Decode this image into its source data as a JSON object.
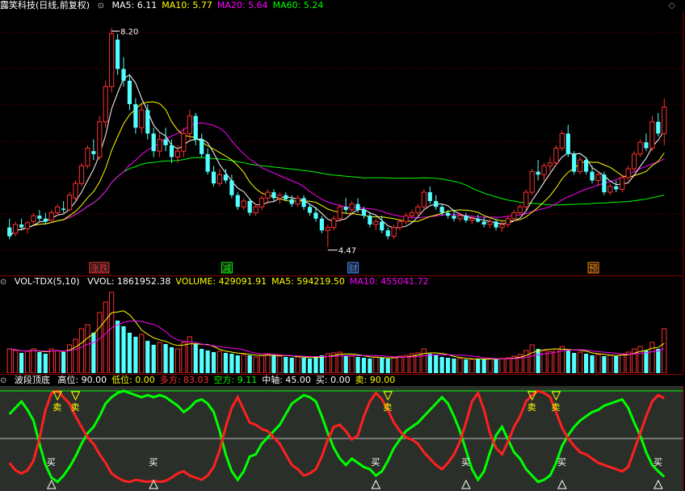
{
  "main": {
    "title": "露笑科技(日线,前复权)",
    "ma": [
      {
        "label": "MA5:",
        "value": "6.11",
        "color": "#ffffff"
      },
      {
        "label": "MA10:",
        "value": "5.77",
        "color": "#ffff00"
      },
      {
        "label": "MA20:",
        "value": "5.64",
        "color": "#ff00ff"
      },
      {
        "label": "MA60:",
        "value": "5.24",
        "color": "#00ff00"
      }
    ],
    "high_label": "8.20",
    "low_label": "4.47",
    "events": [
      {
        "text": "涨跌",
        "color": "#ff3030"
      },
      {
        "text": "减",
        "color": "#00ff00"
      },
      {
        "text": "财",
        "color": "#4090ff"
      },
      {
        "text": "预",
        "color": "#ff8000"
      }
    ]
  },
  "volume": {
    "title": "VOL-TDX(5,10)",
    "items": [
      {
        "label": "VVOL:",
        "value": "1861952.38",
        "color": "#ffffff"
      },
      {
        "label": "VOLUME:",
        "value": "429091.91",
        "color": "#ffff00"
      },
      {
        "label": "MA5:",
        "value": "594219.50",
        "color": "#ffff00"
      },
      {
        "label": "MA10:",
        "value": "455041.72",
        "color": "#ff00ff"
      }
    ]
  },
  "osc": {
    "title": "波段顶底",
    "items": [
      {
        "label": "高位:",
        "value": "90.00",
        "color": "#ffffff"
      },
      {
        "label": "低位:",
        "value": "0.00",
        "color": "#ffff00"
      },
      {
        "label": "多方:",
        "value": "83.03",
        "color": "#ff3030"
      },
      {
        "label": "空方:",
        "value": "9.11",
        "color": "#00ff00"
      },
      {
        "label": "中轴:",
        "value": "45.00",
        "color": "#ffffff"
      },
      {
        "label": "买:",
        "value": "0.00",
        "color": "#ffffff"
      },
      {
        "label": "卖:",
        "value": "90.00",
        "color": "#ffff00"
      }
    ],
    "buy_label": "买",
    "sell_label": "卖"
  },
  "chart_data": {
    "type": "candlestick",
    "price_range": [
      4.3,
      8.4
    ],
    "candles": [
      {
        "o": 4.8,
        "h": 4.95,
        "l": 4.6,
        "c": 4.65
      },
      {
        "o": 4.7,
        "h": 4.9,
        "l": 4.65,
        "c": 4.85
      },
      {
        "o": 4.85,
        "h": 4.95,
        "l": 4.75,
        "c": 4.8
      },
      {
        "o": 4.78,
        "h": 4.9,
        "l": 4.7,
        "c": 4.88
      },
      {
        "o": 4.9,
        "h": 5.05,
        "l": 4.85,
        "c": 5.0
      },
      {
        "o": 5.0,
        "h": 5.1,
        "l": 4.9,
        "c": 4.95
      },
      {
        "o": 4.95,
        "h": 5.05,
        "l": 4.85,
        "c": 4.9
      },
      {
        "o": 4.92,
        "h": 5.1,
        "l": 4.88,
        "c": 5.05
      },
      {
        "o": 5.05,
        "h": 5.2,
        "l": 5.0,
        "c": 5.15
      },
      {
        "o": 5.12,
        "h": 5.25,
        "l": 5.05,
        "c": 5.1
      },
      {
        "o": 5.1,
        "h": 5.4,
        "l": 5.08,
        "c": 5.35
      },
      {
        "o": 5.3,
        "h": 5.6,
        "l": 5.25,
        "c": 5.55
      },
      {
        "o": 5.55,
        "h": 5.9,
        "l": 5.5,
        "c": 5.85
      },
      {
        "o": 5.85,
        "h": 6.2,
        "l": 5.8,
        "c": 6.15
      },
      {
        "o": 6.1,
        "h": 6.3,
        "l": 5.95,
        "c": 6.05
      },
      {
        "o": 6.0,
        "h": 6.7,
        "l": 5.95,
        "c": 6.6
      },
      {
        "o": 6.6,
        "h": 7.3,
        "l": 6.5,
        "c": 7.2
      },
      {
        "o": 7.2,
        "h": 8.2,
        "l": 7.1,
        "c": 8.1
      },
      {
        "o": 8.0,
        "h": 8.1,
        "l": 7.4,
        "c": 7.5
      },
      {
        "o": 7.5,
        "h": 7.7,
        "l": 7.2,
        "c": 7.3
      },
      {
        "o": 7.3,
        "h": 7.4,
        "l": 6.8,
        "c": 6.9
      },
      {
        "o": 6.9,
        "h": 7.0,
        "l": 6.4,
        "c": 6.5
      },
      {
        "o": 6.5,
        "h": 6.9,
        "l": 6.4,
        "c": 6.8
      },
      {
        "o": 6.8,
        "h": 6.9,
        "l": 6.3,
        "c": 6.4
      },
      {
        "o": 6.4,
        "h": 6.5,
        "l": 6.0,
        "c": 6.1
      },
      {
        "o": 6.1,
        "h": 6.4,
        "l": 6.0,
        "c": 6.3
      },
      {
        "o": 6.3,
        "h": 6.5,
        "l": 6.1,
        "c": 6.2
      },
      {
        "o": 6.2,
        "h": 6.3,
        "l": 5.9,
        "c": 6.0
      },
      {
        "o": 6.0,
        "h": 6.2,
        "l": 5.9,
        "c": 6.1
      },
      {
        "o": 6.1,
        "h": 6.5,
        "l": 6.0,
        "c": 6.4
      },
      {
        "o": 6.4,
        "h": 6.8,
        "l": 6.3,
        "c": 6.7
      },
      {
        "o": 6.7,
        "h": 6.75,
        "l": 6.2,
        "c": 6.3
      },
      {
        "o": 6.3,
        "h": 6.4,
        "l": 6.0,
        "c": 6.05
      },
      {
        "o": 6.05,
        "h": 6.15,
        "l": 5.7,
        "c": 5.75
      },
      {
        "o": 5.75,
        "h": 5.85,
        "l": 5.5,
        "c": 5.55
      },
      {
        "o": 5.55,
        "h": 5.8,
        "l": 5.5,
        "c": 5.7
      },
      {
        "o": 5.7,
        "h": 5.8,
        "l": 5.55,
        "c": 5.6
      },
      {
        "o": 5.6,
        "h": 5.7,
        "l": 5.3,
        "c": 5.35
      },
      {
        "o": 5.35,
        "h": 5.4,
        "l": 5.1,
        "c": 5.15
      },
      {
        "o": 5.15,
        "h": 5.3,
        "l": 5.1,
        "c": 5.25
      },
      {
        "o": 5.25,
        "h": 5.3,
        "l": 5.0,
        "c": 5.05
      },
      {
        "o": 5.05,
        "h": 5.2,
        "l": 5.0,
        "c": 5.15
      },
      {
        "o": 5.15,
        "h": 5.35,
        "l": 5.1,
        "c": 5.3
      },
      {
        "o": 5.3,
        "h": 5.45,
        "l": 5.2,
        "c": 5.4
      },
      {
        "o": 5.4,
        "h": 5.45,
        "l": 5.25,
        "c": 5.3
      },
      {
        "o": 5.3,
        "h": 5.4,
        "l": 5.2,
        "c": 5.35
      },
      {
        "o": 5.35,
        "h": 5.4,
        "l": 5.25,
        "c": 5.28
      },
      {
        "o": 5.28,
        "h": 5.35,
        "l": 5.15,
        "c": 5.2
      },
      {
        "o": 5.2,
        "h": 5.35,
        "l": 5.15,
        "c": 5.3
      },
      {
        "o": 5.3,
        "h": 5.35,
        "l": 5.1,
        "c": 5.15
      },
      {
        "o": 5.15,
        "h": 5.2,
        "l": 5.0,
        "c": 5.05
      },
      {
        "o": 5.05,
        "h": 5.15,
        "l": 4.9,
        "c": 4.95
      },
      {
        "o": 4.95,
        "h": 5.0,
        "l": 4.7,
        "c": 4.75
      },
      {
        "o": 4.75,
        "h": 4.85,
        "l": 4.47,
        "c": 4.8
      },
      {
        "o": 4.8,
        "h": 5.0,
        "l": 4.75,
        "c": 4.95
      },
      {
        "o": 4.95,
        "h": 5.2,
        "l": 4.9,
        "c": 5.15
      },
      {
        "o": 5.15,
        "h": 5.3,
        "l": 5.05,
        "c": 5.1
      },
      {
        "o": 5.1,
        "h": 5.25,
        "l": 5.0,
        "c": 5.2
      },
      {
        "o": 5.2,
        "h": 5.3,
        "l": 5.05,
        "c": 5.1
      },
      {
        "o": 5.1,
        "h": 5.15,
        "l": 4.95,
        "c": 5.0
      },
      {
        "o": 5.0,
        "h": 5.05,
        "l": 4.8,
        "c": 4.85
      },
      {
        "o": 4.85,
        "h": 4.95,
        "l": 4.75,
        "c": 4.9
      },
      {
        "o": 4.9,
        "h": 5.0,
        "l": 4.7,
        "c": 4.75
      },
      {
        "o": 4.75,
        "h": 4.8,
        "l": 4.6,
        "c": 4.65
      },
      {
        "o": 4.65,
        "h": 4.85,
        "l": 4.6,
        "c": 4.8
      },
      {
        "o": 4.8,
        "h": 4.95,
        "l": 4.75,
        "c": 4.9
      },
      {
        "o": 4.9,
        "h": 5.05,
        "l": 4.85,
        "c": 5.0
      },
      {
        "o": 5.0,
        "h": 5.1,
        "l": 4.95,
        "c": 5.05
      },
      {
        "o": 5.05,
        "h": 5.2,
        "l": 5.0,
        "c": 5.15
      },
      {
        "o": 5.15,
        "h": 5.45,
        "l": 5.1,
        "c": 5.4
      },
      {
        "o": 5.4,
        "h": 5.5,
        "l": 5.2,
        "c": 5.25
      },
      {
        "o": 5.25,
        "h": 5.35,
        "l": 5.1,
        "c": 5.15
      },
      {
        "o": 5.15,
        "h": 5.2,
        "l": 5.0,
        "c": 5.05
      },
      {
        "o": 5.05,
        "h": 5.1,
        "l": 4.95,
        "c": 5.0
      },
      {
        "o": 5.0,
        "h": 5.1,
        "l": 4.9,
        "c": 4.95
      },
      {
        "o": 4.95,
        "h": 5.05,
        "l": 4.9,
        "c": 5.0
      },
      {
        "o": 5.0,
        "h": 5.05,
        "l": 4.88,
        "c": 4.92
      },
      {
        "o": 4.92,
        "h": 5.0,
        "l": 4.85,
        "c": 4.95
      },
      {
        "o": 4.95,
        "h": 5.02,
        "l": 4.88,
        "c": 4.9
      },
      {
        "o": 4.9,
        "h": 4.98,
        "l": 4.8,
        "c": 4.85
      },
      {
        "o": 4.85,
        "h": 4.95,
        "l": 4.78,
        "c": 4.9
      },
      {
        "o": 4.9,
        "h": 4.95,
        "l": 4.75,
        "c": 4.8
      },
      {
        "o": 4.8,
        "h": 4.9,
        "l": 4.72,
        "c": 4.85
      },
      {
        "o": 4.85,
        "h": 5.0,
        "l": 4.8,
        "c": 4.95
      },
      {
        "o": 4.95,
        "h": 5.1,
        "l": 4.9,
        "c": 5.05
      },
      {
        "o": 5.05,
        "h": 5.2,
        "l": 5.0,
        "c": 5.15
      },
      {
        "o": 5.15,
        "h": 5.45,
        "l": 5.1,
        "c": 5.4
      },
      {
        "o": 5.4,
        "h": 5.8,
        "l": 5.35,
        "c": 5.75
      },
      {
        "o": 5.75,
        "h": 5.95,
        "l": 5.6,
        "c": 5.7
      },
      {
        "o": 5.7,
        "h": 5.9,
        "l": 5.6,
        "c": 5.85
      },
      {
        "o": 5.85,
        "h": 6.0,
        "l": 5.75,
        "c": 5.9
      },
      {
        "o": 5.9,
        "h": 6.2,
        "l": 5.85,
        "c": 6.15
      },
      {
        "o": 6.15,
        "h": 6.45,
        "l": 6.1,
        "c": 6.4
      },
      {
        "o": 6.4,
        "h": 6.55,
        "l": 6.0,
        "c": 6.05
      },
      {
        "o": 6.05,
        "h": 6.1,
        "l": 5.7,
        "c": 5.75
      },
      {
        "o": 5.75,
        "h": 6.0,
        "l": 5.7,
        "c": 5.95
      },
      {
        "o": 5.95,
        "h": 6.0,
        "l": 5.7,
        "c": 5.75
      },
      {
        "o": 5.75,
        "h": 5.85,
        "l": 5.55,
        "c": 5.6
      },
      {
        "o": 5.6,
        "h": 5.75,
        "l": 5.5,
        "c": 5.7
      },
      {
        "o": 5.7,
        "h": 5.75,
        "l": 5.35,
        "c": 5.4
      },
      {
        "o": 5.4,
        "h": 5.55,
        "l": 5.35,
        "c": 5.5
      },
      {
        "o": 5.5,
        "h": 5.6,
        "l": 5.4,
        "c": 5.45
      },
      {
        "o": 5.45,
        "h": 5.7,
        "l": 5.4,
        "c": 5.65
      },
      {
        "o": 5.65,
        "h": 5.85,
        "l": 5.6,
        "c": 5.8
      },
      {
        "o": 5.8,
        "h": 6.1,
        "l": 5.75,
        "c": 6.05
      },
      {
        "o": 6.05,
        "h": 6.3,
        "l": 6.0,
        "c": 6.25
      },
      {
        "o": 6.25,
        "h": 6.4,
        "l": 6.1,
        "c": 6.15
      },
      {
        "o": 6.15,
        "h": 6.7,
        "l": 6.1,
        "c": 6.6
      },
      {
        "o": 6.6,
        "h": 6.75,
        "l": 6.35,
        "c": 6.4
      },
      {
        "o": 6.4,
        "h": 7.0,
        "l": 6.2,
        "c": 6.85
      }
    ],
    "volume": [
      0.3,
      0.28,
      0.25,
      0.27,
      0.3,
      0.26,
      0.24,
      0.3,
      0.28,
      0.26,
      0.35,
      0.42,
      0.55,
      0.6,
      0.5,
      0.75,
      0.88,
      1.0,
      0.65,
      0.58,
      0.5,
      0.45,
      0.48,
      0.4,
      0.35,
      0.38,
      0.36,
      0.32,
      0.3,
      0.38,
      0.45,
      0.36,
      0.3,
      0.28,
      0.26,
      0.27,
      0.25,
      0.24,
      0.22,
      0.23,
      0.22,
      0.2,
      0.22,
      0.24,
      0.22,
      0.21,
      0.2,
      0.19,
      0.2,
      0.19,
      0.18,
      0.2,
      0.22,
      0.24,
      0.25,
      0.26,
      0.22,
      0.21,
      0.2,
      0.19,
      0.18,
      0.2,
      0.19,
      0.18,
      0.2,
      0.21,
      0.22,
      0.24,
      0.25,
      0.3,
      0.24,
      0.22,
      0.2,
      0.19,
      0.18,
      0.18,
      0.17,
      0.17,
      0.18,
      0.17,
      0.18,
      0.17,
      0.18,
      0.19,
      0.21,
      0.23,
      0.28,
      0.35,
      0.3,
      0.28,
      0.27,
      0.3,
      0.33,
      0.28,
      0.25,
      0.26,
      0.24,
      0.22,
      0.23,
      0.21,
      0.22,
      0.21,
      0.24,
      0.26,
      0.3,
      0.33,
      0.28,
      0.38,
      0.3,
      0.55
    ],
    "volume_up": [
      1,
      1,
      0,
      1,
      1,
      0,
      0,
      1,
      1,
      0,
      1,
      1,
      1,
      1,
      0,
      1,
      1,
      1,
      0,
      0,
      0,
      0,
      1,
      0,
      0,
      1,
      0,
      0,
      1,
      1,
      1,
      0,
      0,
      0,
      0,
      1,
      0,
      0,
      0,
      1,
      0,
      1,
      1,
      1,
      0,
      1,
      0,
      0,
      1,
      0,
      0,
      0,
      0,
      1,
      1,
      1,
      0,
      1,
      0,
      0,
      0,
      1,
      0,
      0,
      1,
      1,
      1,
      1,
      1,
      1,
      0,
      0,
      0,
      0,
      0,
      1,
      0,
      1,
      0,
      0,
      1,
      0,
      1,
      1,
      1,
      1,
      1,
      1,
      0,
      1,
      1,
      1,
      1,
      0,
      0,
      1,
      0,
      0,
      1,
      0,
      1,
      0,
      1,
      1,
      1,
      1,
      0,
      1,
      0,
      1
    ],
    "osc_bull": [
      22,
      15,
      12,
      15,
      24,
      45,
      72,
      88,
      90,
      84,
      78,
      66,
      56,
      46,
      40,
      30,
      22,
      12,
      8,
      5,
      4,
      6,
      5,
      4,
      5,
      4,
      5,
      8,
      12,
      14,
      10,
      8,
      6,
      10,
      18,
      34,
      56,
      74,
      84,
      72,
      60,
      58,
      54,
      52,
      46,
      40,
      30,
      20,
      16,
      10,
      12,
      16,
      28,
      44,
      56,
      58,
      52,
      44,
      48,
      66,
      80,
      88,
      82,
      72,
      60,
      52,
      46,
      44,
      40,
      32,
      26,
      20,
      16,
      22,
      30,
      42,
      60,
      80,
      88,
      72,
      50,
      36,
      30,
      42,
      56,
      66,
      80,
      86,
      90,
      88,
      84,
      70,
      55,
      45,
      38,
      32,
      30,
      26,
      22,
      20,
      18,
      16,
      14,
      18,
      34,
      50,
      66,
      80,
      86,
      83
    ],
    "osc_bear": [
      68,
      74,
      80,
      72,
      62,
      40,
      20,
      8,
      4,
      10,
      18,
      28,
      40,
      50,
      56,
      66,
      78,
      84,
      88,
      90,
      88,
      86,
      84,
      86,
      84,
      86,
      84,
      80,
      76,
      70,
      74,
      80,
      82,
      78,
      70,
      52,
      30,
      14,
      6,
      14,
      28,
      30,
      40,
      46,
      52,
      58,
      68,
      78,
      82,
      86,
      84,
      80,
      66,
      50,
      36,
      26,
      20,
      26,
      22,
      18,
      16,
      10,
      14,
      24,
      36,
      44,
      52,
      56,
      60,
      66,
      72,
      78,
      84,
      78,
      66,
      52,
      34,
      16,
      6,
      14,
      32,
      48,
      56,
      44,
      32,
      26,
      16,
      10,
      4,
      6,
      10,
      22,
      38,
      48,
      56,
      62,
      66,
      70,
      72,
      76,
      78,
      80,
      82,
      74,
      60,
      48,
      32,
      20,
      14,
      9
    ],
    "buy_index": [
      7,
      24,
      61,
      76,
      92,
      108
    ],
    "sell_index": [
      8,
      11,
      63,
      87,
      91
    ]
  }
}
